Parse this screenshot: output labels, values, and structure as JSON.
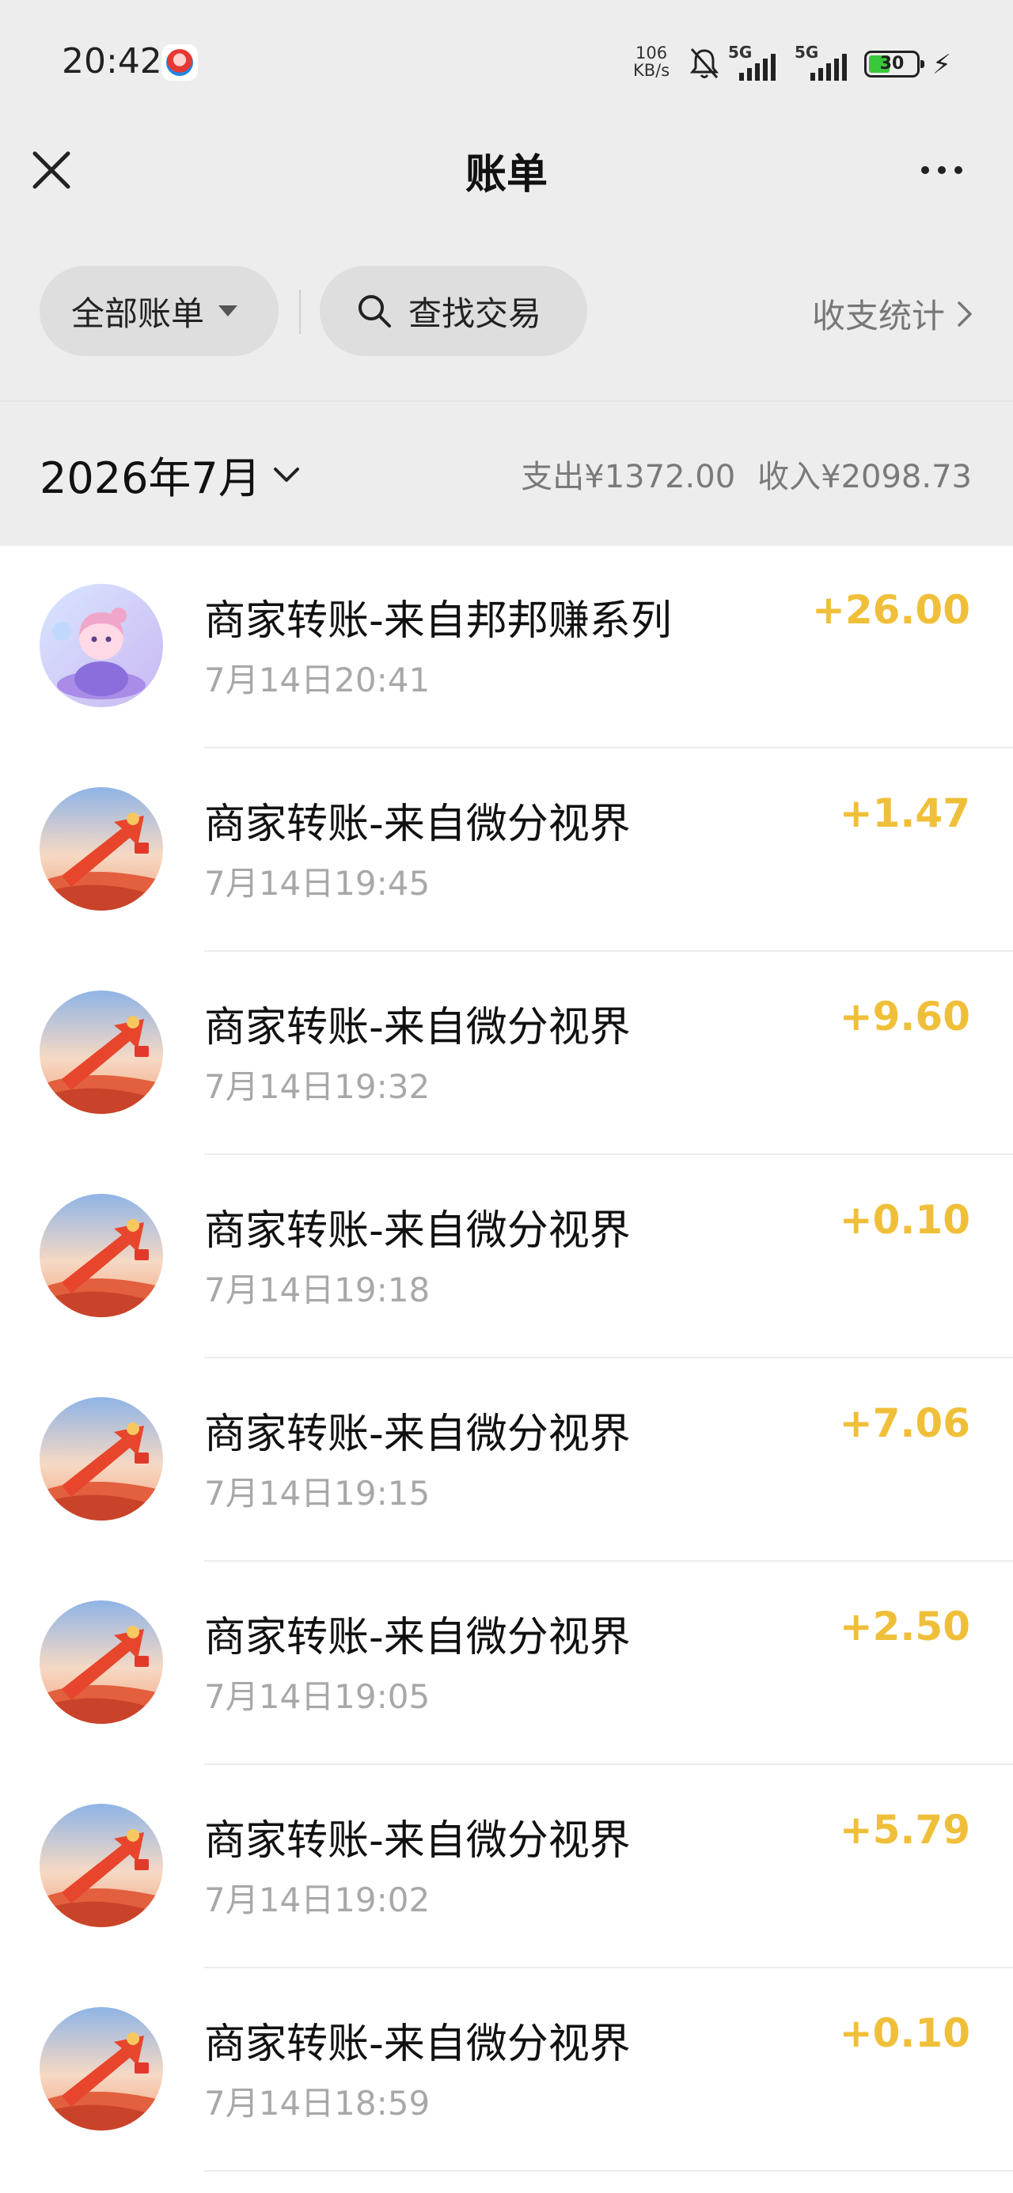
{
  "status_bar": {
    "time": "20:42",
    "net_speed_value": "106",
    "net_speed_unit": "KB/s",
    "sim1_label": "5G",
    "sim2_label": "5G",
    "battery_level": "30",
    "app_icon": "app-notification-icon"
  },
  "nav": {
    "title": "账单",
    "close_icon": "close-icon",
    "more_icon": "more-icon"
  },
  "filters": {
    "all_bills_label": "全部账单",
    "search_label": "查找交易",
    "stats_label": "收支统计"
  },
  "month": {
    "label": "2026年7月",
    "expense": "支出¥1372.00",
    "income": "收入¥2098.73"
  },
  "colors": {
    "income_amount": "#f0bf3a",
    "background": "#ededed"
  },
  "transactions": [
    {
      "title": "商家转账-来自邦邦赚系列",
      "time": "7月14日20:41",
      "amount": "+26.00",
      "avatar": "anime-character-avatar"
    },
    {
      "title": "商家转账-来自微分视界",
      "time": "7月14日19:45",
      "amount": "+1.47",
      "avatar": "red-arrow-avatar"
    },
    {
      "title": "商家转账-来自微分视界",
      "time": "7月14日19:32",
      "amount": "+9.60",
      "avatar": "red-arrow-avatar"
    },
    {
      "title": "商家转账-来自微分视界",
      "time": "7月14日19:18",
      "amount": "+0.10",
      "avatar": "red-arrow-avatar"
    },
    {
      "title": "商家转账-来自微分视界",
      "time": "7月14日19:15",
      "amount": "+7.06",
      "avatar": "red-arrow-avatar"
    },
    {
      "title": "商家转账-来自微分视界",
      "time": "7月14日19:05",
      "amount": "+2.50",
      "avatar": "red-arrow-avatar"
    },
    {
      "title": "商家转账-来自微分视界",
      "time": "7月14日19:02",
      "amount": "+5.79",
      "avatar": "red-arrow-avatar"
    },
    {
      "title": "商家转账-来自微分视界",
      "time": "7月14日18:59",
      "amount": "+0.10",
      "avatar": "red-arrow-avatar"
    }
  ]
}
